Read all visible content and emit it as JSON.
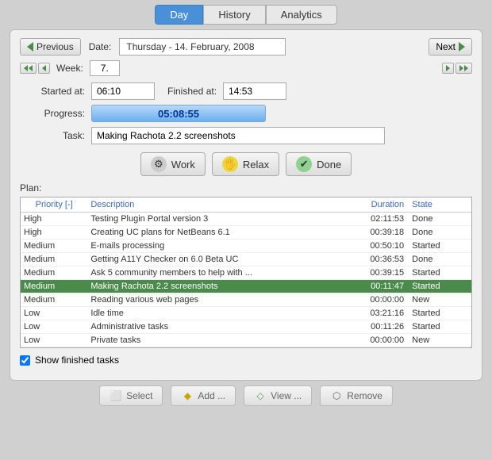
{
  "tabs": [
    {
      "label": "Day",
      "active": true
    },
    {
      "label": "History",
      "active": false
    },
    {
      "label": "Analytics",
      "active": false
    }
  ],
  "nav": {
    "previous_label": "Previous",
    "next_label": "Next",
    "date_label": "Date:",
    "date_value": "Thursday - 14. February, 2008",
    "week_label": "Week:",
    "week_value": "7."
  },
  "fields": {
    "started_label": "Started at:",
    "started_value": "06:10",
    "finished_label": "Finished at:",
    "finished_value": "14:53",
    "progress_label": "Progress:",
    "progress_value": "05:08:55",
    "task_label": "Task:",
    "task_value": "Making Rachota 2.2 screenshots"
  },
  "action_buttons": [
    {
      "label": "Work",
      "icon": "⚙"
    },
    {
      "label": "Relax",
      "icon": "🖐"
    },
    {
      "label": "Done",
      "icon": "✔"
    }
  ],
  "plan_label": "Plan:",
  "table": {
    "headers": [
      "Priority [-]",
      "Description",
      "Duration",
      "State",
      ""
    ],
    "rows": [
      {
        "priority": "High",
        "description": "Testing Plugin Portal version 3",
        "duration": "02:11:53",
        "state": "Done",
        "highlighted": false
      },
      {
        "priority": "High",
        "description": "Creating UC plans for NetBeans 6.1",
        "duration": "00:39:18",
        "state": "Done",
        "highlighted": false
      },
      {
        "priority": "Medium",
        "description": "E-mails processing",
        "duration": "00:50:10",
        "state": "Started",
        "highlighted": false
      },
      {
        "priority": "Medium",
        "description": "Getting A11Y Checker on 6.0 Beta UC",
        "duration": "00:36:53",
        "state": "Done",
        "highlighted": false
      },
      {
        "priority": "Medium",
        "description": "Ask 5 community members to help with ...",
        "duration": "00:39:15",
        "state": "Started",
        "highlighted": false
      },
      {
        "priority": "Medium",
        "description": "Making Rachota 2.2 screenshots",
        "duration": "00:11:47",
        "state": "Started",
        "highlighted": true
      },
      {
        "priority": "Medium",
        "description": "Reading various web pages",
        "duration": "00:00:00",
        "state": "New",
        "highlighted": false
      },
      {
        "priority": "Low",
        "description": "Idle time",
        "duration": "03:21:16",
        "state": "Started",
        "highlighted": false
      },
      {
        "priority": "Low",
        "description": "Administrative tasks",
        "duration": "00:11:26",
        "state": "Started",
        "highlighted": false
      },
      {
        "priority": "Low",
        "description": "Private tasks",
        "duration": "00:00:00",
        "state": "New",
        "highlighted": false
      }
    ]
  },
  "show_finished": {
    "label": "Show finished tasks",
    "checked": true
  },
  "bottom_buttons": [
    {
      "label": "Select",
      "icon": "⬜"
    },
    {
      "label": "Add ...",
      "icon": "◆"
    },
    {
      "label": "View ...",
      "icon": "◇"
    },
    {
      "label": "Remove",
      "icon": "⬡"
    }
  ]
}
